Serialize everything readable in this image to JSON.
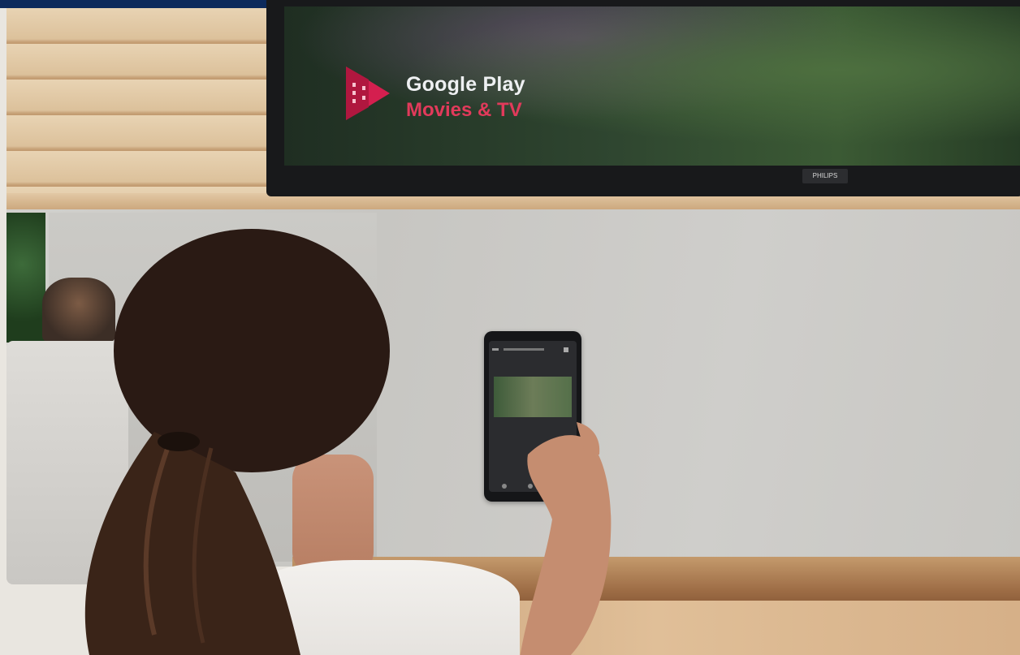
{
  "tv": {
    "logo_line1": "Google Play",
    "logo_line2": "Movies & TV",
    "brand_text": "PHILIPS"
  },
  "colors": {
    "accent_red": "#e23a5b",
    "top_strip": "#0d2a5c"
  },
  "icons": {
    "logo": "google-play-movies-icon"
  }
}
